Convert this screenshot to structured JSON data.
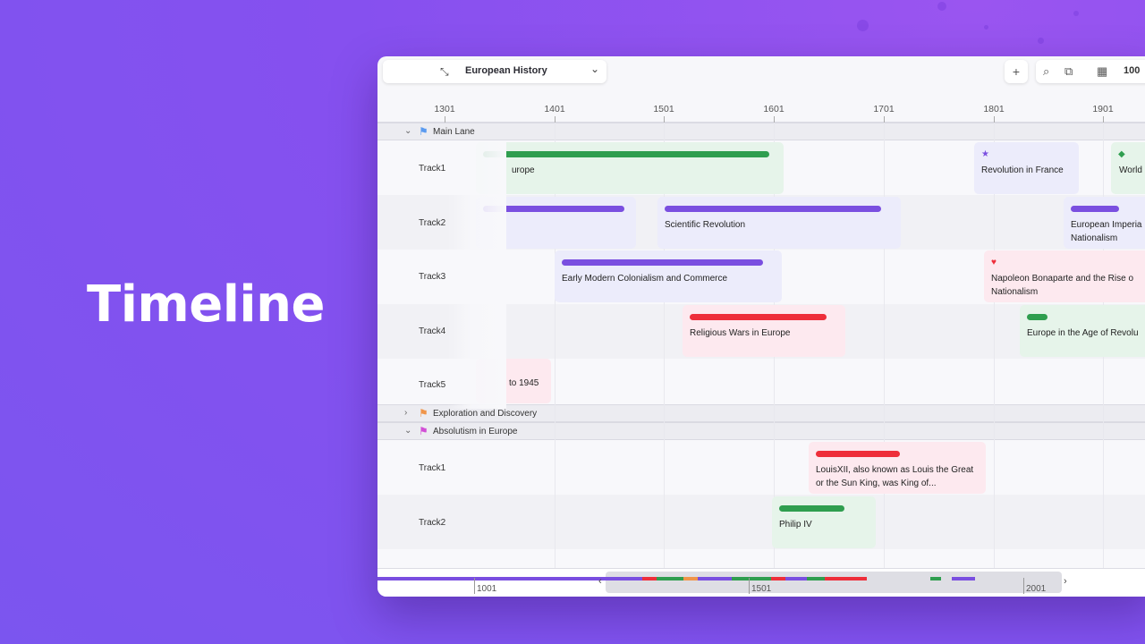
{
  "hero": {
    "title": "Timeline"
  },
  "window": {
    "picker_title": "European History",
    "zoom_label": "100"
  },
  "ruler": {
    "ticks": [
      "1301",
      "1401",
      "1501",
      "1601",
      "1701",
      "1801",
      "1901"
    ]
  },
  "lanes": [
    {
      "name": "Main Lane",
      "flag_color": "#5b9bf0",
      "expanded": true,
      "tracks": [
        "Track1",
        "Track2",
        "Track3",
        "Track4",
        "Track5"
      ]
    },
    {
      "name": "Exploration and Discovery",
      "flag_color": "#f0954a",
      "expanded": false,
      "tracks": []
    },
    {
      "name": "Absolutism in Europe",
      "flag_color": "#d24fd6",
      "expanded": true,
      "tracks": [
        "Track1",
        "Track2"
      ]
    }
  ],
  "events": {
    "e1": "urope",
    "e2": "Revolution in France",
    "e3": "World",
    "e4": "Scientific Revolution",
    "e5": "European Imperia",
    "e5b": "Nationalism",
    "e6": "Early Modern Colonialism and Commerce",
    "e7": "Napoleon Bonaparte and the Rise o",
    "e7b": "Nationalism",
    "e8": "Religious Wars in Europe",
    "e9": "Europe in the Age of Revolu",
    "e10": "to 1945",
    "e11": "LouisXII, also known as Louis the Great or the Sun King, was King of...",
    "e12": "Philip IV"
  },
  "colors": {
    "green": "#2f9e4f",
    "purple": "#7a4fe0",
    "red": "#ee2e3a"
  },
  "minimap": {
    "labels": [
      "1001",
      "1501",
      "2001"
    ]
  }
}
